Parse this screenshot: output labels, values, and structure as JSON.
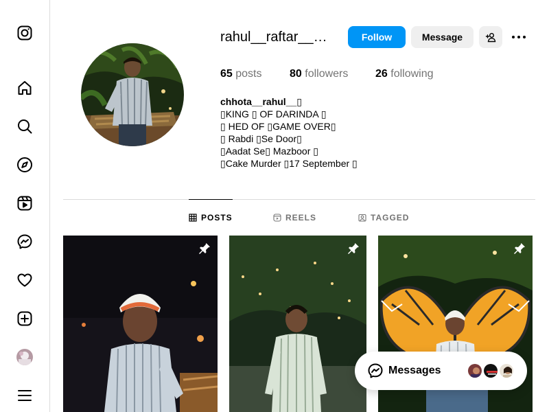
{
  "sidebar": {
    "items": [
      {
        "icon": "instagram-logo-icon"
      },
      {
        "icon": "home-icon"
      },
      {
        "icon": "search-icon"
      },
      {
        "icon": "explore-compass-icon"
      },
      {
        "icon": "reels-icon"
      },
      {
        "icon": "messenger-icon"
      },
      {
        "icon": "heart-icon"
      },
      {
        "icon": "create-plus-icon"
      },
      {
        "icon": "profile-avatar"
      },
      {
        "icon": "menu-hamburger-icon"
      }
    ]
  },
  "profile": {
    "username": "rahul__raftar__…",
    "follow_label": "Follow",
    "message_label": "Message",
    "stats": {
      "posts_count": "65",
      "posts_label": "posts",
      "followers_count": "80",
      "followers_label": "followers",
      "following_count": "26",
      "following_label": "following"
    },
    "full_name": "chhota__rahul__▯",
    "bio_lines": [
      "▯KING ▯ OF DARINDA ▯",
      "▯ HED OF ▯GAME OVER▯",
      "▯ Rabdi ▯Se Door▯",
      "▯Aadat Se▯ Mazboor ▯",
      "▯Cake Murder ▯17 September ▯"
    ]
  },
  "tabs": [
    {
      "label": "POSTS",
      "active": true
    },
    {
      "label": "REELS",
      "active": false
    },
    {
      "label": "TAGGED",
      "active": false
    }
  ],
  "messages": {
    "label": "Messages"
  },
  "colors": {
    "accent": "#0095f6",
    "secondary_button": "#efefef",
    "muted_text": "#737373",
    "border": "#dbdbdb"
  }
}
